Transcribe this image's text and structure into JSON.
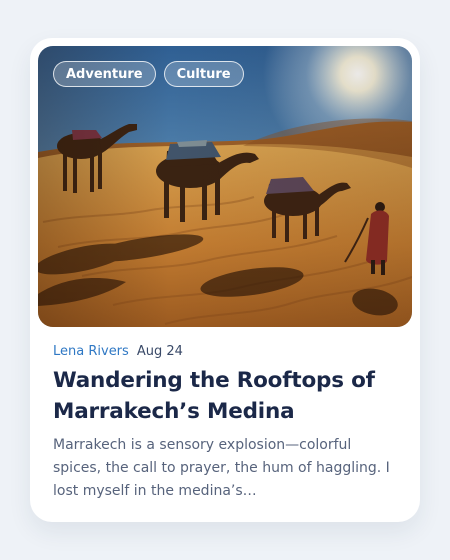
{
  "card": {
    "tags": [
      "Adventure",
      "Culture"
    ],
    "image": {
      "subject": "camel caravan crossing desert dunes"
    },
    "author": "Lena Rivers",
    "date": "Aug 24",
    "title": "Wandering the Rooftops of Marrakech’s Medina",
    "excerpt": "Marrakech is a sensory explosion—colorful spices, the call to prayer, the hum of haggling. I lost myself in the medina’s…"
  },
  "colors": {
    "page_background": "#eef2f7",
    "card_background": "#ffffff",
    "author_link": "#2f78c4",
    "title": "#1b2848",
    "body_text": "#57637c"
  }
}
